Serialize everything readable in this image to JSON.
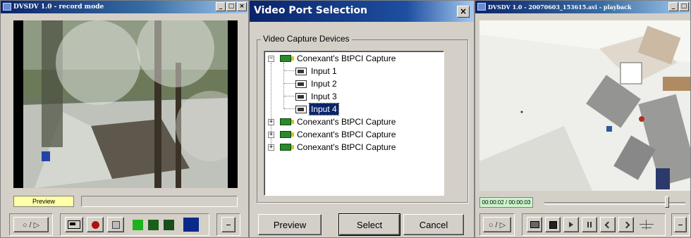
{
  "record_window": {
    "title": "DVSDV 1.0 - record mode",
    "window_buttons": [
      "_",
      "□",
      "×"
    ],
    "preview_label": "Preview",
    "play_toggle_label": "○ / ▷",
    "indicator_colors": [
      "#1db31d",
      "#1a5e1a",
      "#1a4f1a",
      "#0a2a8a"
    ]
  },
  "dialog": {
    "title": "Video Port Selection",
    "close_label": "×",
    "group_label": "Video Capture Devices",
    "tree": [
      {
        "label": "Conexant's BtPCI Capture",
        "expanded": true,
        "children": [
          "Input 1",
          "Input 2",
          "Input 3",
          "Input 4"
        ]
      },
      {
        "label": "Conexant's BtPCI Capture",
        "expanded": false
      },
      {
        "label": "Conexant's BtPCI Capture",
        "expanded": false
      },
      {
        "label": "Conexant's BtPCI Capture",
        "expanded": false
      }
    ],
    "selected_item": "Input 4",
    "buttons": {
      "preview": "Preview",
      "select": "Select",
      "cancel": "Cancel"
    }
  },
  "playback_window": {
    "title": "DVSDV 1.0 - 20070603_153615.avi - playback",
    "window_buttons": [
      "_",
      "□"
    ],
    "time_display": "00:00:02 / 00:00:03",
    "seek_position": 0.87,
    "play_toggle_label": "○ / ▷"
  }
}
